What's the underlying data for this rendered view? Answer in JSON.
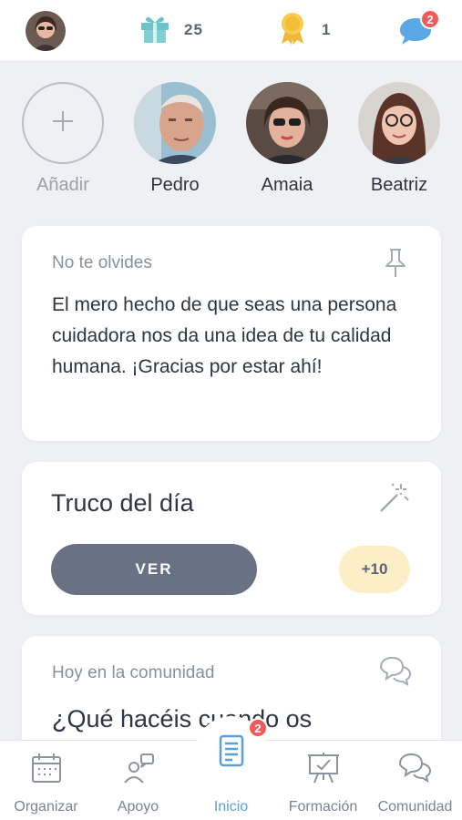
{
  "header": {
    "gifts_count": "25",
    "medals_count": "1",
    "messages_badge": "2",
    "icons": {
      "gift": "gift-icon",
      "medal": "medal-icon",
      "chat": "chat-bubble-icon"
    }
  },
  "contacts": {
    "add_label": "Añadir",
    "people": [
      {
        "name": "Pedro"
      },
      {
        "name": "Amaia"
      },
      {
        "name": "Beatriz"
      }
    ]
  },
  "reminder_card": {
    "label": "No te olvides",
    "message": "El mero hecho de que seas una persona cuidadora nos da una idea de tu calidad humana. ¡Gracias por estar ahí!",
    "icon": "pin-icon"
  },
  "tip_card": {
    "title": "Truco del día",
    "button_label": "VER",
    "points": "+10",
    "icon": "magic-wand-icon"
  },
  "community_card": {
    "label": "Hoy en la comunidad",
    "question": "¿Qué hacéis cuando os",
    "icon": "chat-bubbles-icon"
  },
  "bottom_nav": {
    "items": [
      {
        "label": "Organizar",
        "icon": "calendar-icon"
      },
      {
        "label": "Apoyo",
        "icon": "support-people-icon"
      },
      {
        "label": "Inicio",
        "icon": "notebook-icon",
        "badge": "2"
      },
      {
        "label": "Formación",
        "icon": "presentation-board-icon"
      },
      {
        "label": "Comunidad",
        "icon": "community-chat-icon"
      }
    ]
  },
  "colors": {
    "background": "#eef0f4",
    "primary_button": "#697185",
    "points_pill": "#fcefc8",
    "active_nav": "#5aa0dc",
    "badge": "#ef5b5b",
    "gift": "#6cc3c9",
    "medal": "#f5c542",
    "chat": "#5aa8e6"
  }
}
